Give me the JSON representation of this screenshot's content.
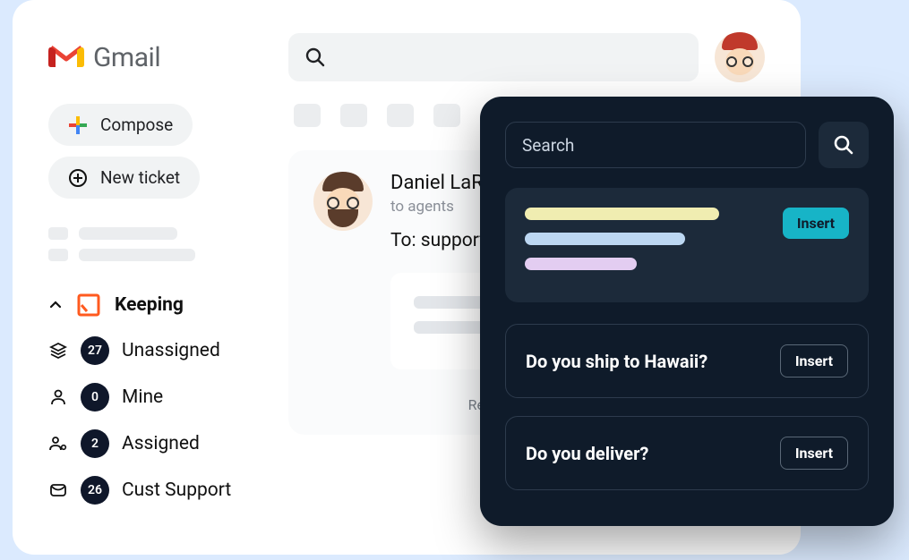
{
  "header": {
    "brand": "Gmail",
    "search_placeholder": ""
  },
  "sidebar": {
    "compose_label": "Compose",
    "new_ticket_label": "New ticket",
    "section_title": "Keeping",
    "items": [
      {
        "icon": "stack",
        "count": "27",
        "label": "Unassigned"
      },
      {
        "icon": "person",
        "count": "0",
        "label": "Mine"
      },
      {
        "icon": "people",
        "count": "2",
        "label": "Assigned"
      },
      {
        "icon": "envelope",
        "count": "26",
        "label": "Cust Support"
      }
    ]
  },
  "email": {
    "sender_name": "Daniel LaRu",
    "recipients_label": "to agents",
    "to_line": "To: support@",
    "reply_note": "Replying to this no"
  },
  "popover": {
    "search_placeholder": "Search",
    "insert_label": "Insert",
    "canned": [
      {
        "question": "Do you ship to Hawaii?",
        "action": "Insert"
      },
      {
        "question": "Do you deliver?",
        "action": "Insert"
      }
    ]
  }
}
